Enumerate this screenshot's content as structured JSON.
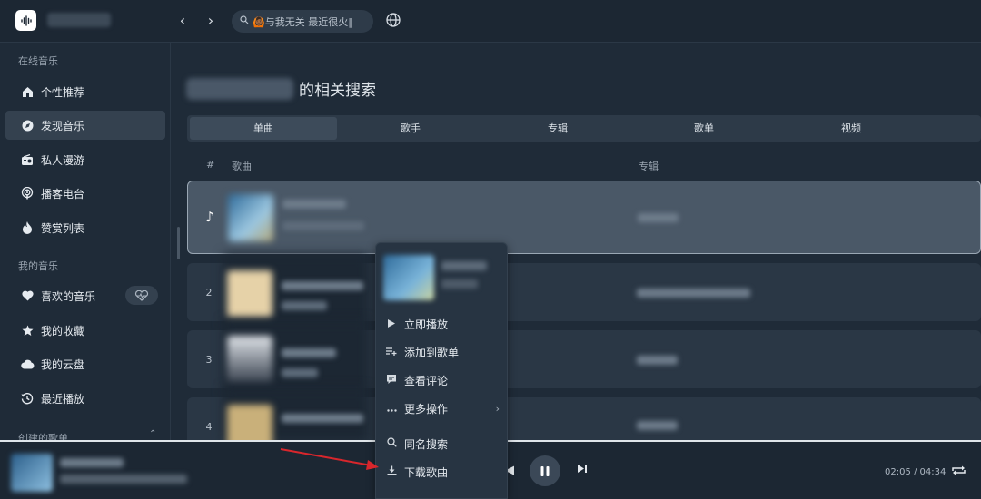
{
  "header": {
    "search_placeholder": "🙆🏾与我无关 最近很火‖",
    "nav_back": "‹",
    "nav_forward": "›"
  },
  "sidebar": {
    "section_online": "在线音乐",
    "items_online": [
      {
        "label": "个性推荐",
        "icon": "home-icon"
      },
      {
        "label": "发现音乐",
        "icon": "disc-icon"
      },
      {
        "label": "私人漫游",
        "icon": "radio-icon"
      },
      {
        "label": "播客电台",
        "icon": "podcast-icon"
      },
      {
        "label": "赞赏列表",
        "icon": "flame-icon"
      }
    ],
    "section_mine": "我的音乐",
    "items_mine": [
      {
        "label": "喜欢的音乐",
        "icon": "heart-icon"
      },
      {
        "label": "我的收藏",
        "icon": "star-icon"
      },
      {
        "label": "我的云盘",
        "icon": "cloud-icon"
      },
      {
        "label": "最近播放",
        "icon": "history-icon"
      }
    ],
    "section_created": "创建的歌单"
  },
  "main": {
    "title_suffix": "的相关搜索",
    "tabs": [
      "单曲",
      "歌手",
      "专辑",
      "歌单",
      "视频"
    ],
    "active_tab": "单曲",
    "columns": {
      "index": "#",
      "song": "歌曲",
      "album": "专辑"
    },
    "rows": [
      {
        "index": "♪"
      },
      {
        "index": "2"
      },
      {
        "index": "3"
      },
      {
        "index": "4"
      }
    ]
  },
  "context_menu": {
    "items": [
      {
        "label": "立即播放",
        "icon": "play-icon"
      },
      {
        "label": "添加到歌单",
        "icon": "add-to-playlist-icon"
      },
      {
        "label": "查看评论",
        "icon": "comment-icon"
      },
      {
        "label": "更多操作",
        "icon": "more-icon"
      },
      {
        "label": "同名搜索",
        "icon": "search-icon"
      },
      {
        "label": "下载歌曲",
        "icon": "download-icon"
      }
    ]
  },
  "player": {
    "time": "02:05 / 04:34"
  },
  "colors": {
    "background": "#1f2b38",
    "annotation_arrow": "#d8262c"
  }
}
